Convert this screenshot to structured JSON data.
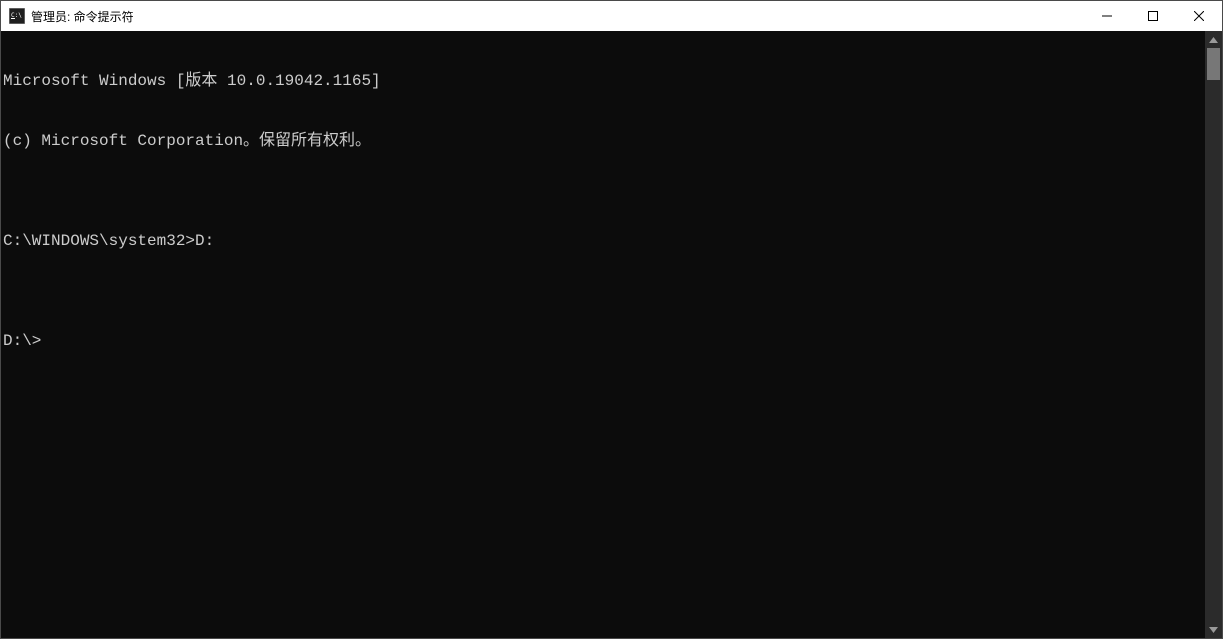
{
  "window": {
    "title": "管理员: 命令提示符"
  },
  "terminal": {
    "lines": [
      "Microsoft Windows [版本 10.0.19042.1165]",
      "(c) Microsoft Corporation。保留所有权利。",
      "",
      "C:\\WINDOWS\\system32>D:",
      "",
      "D:\\>"
    ]
  },
  "icons": {
    "app": "cmd-icon",
    "minimize": "minimize-icon",
    "maximize": "maximize-icon",
    "close": "close-icon",
    "scroll_up": "chevron-up-icon",
    "scroll_down": "chevron-down-icon"
  }
}
